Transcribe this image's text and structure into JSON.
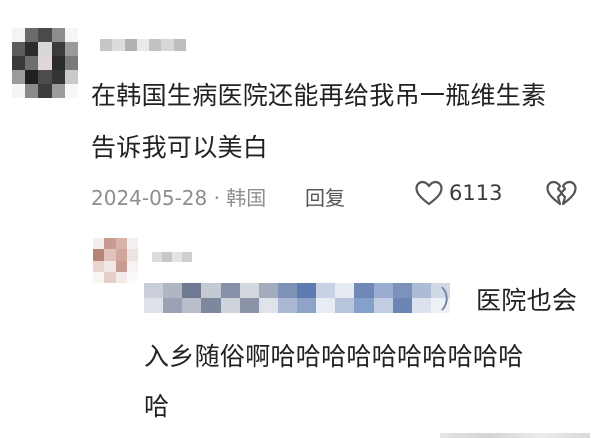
{
  "comment": {
    "text_line1": "在韩国生病医院还能再给我吊一瓶维生素",
    "text_line2": "告诉我可以美白",
    "date": "2024-05-28 · 韩国",
    "reply_label": "回复",
    "like_count": "6113",
    "icons": {
      "like": "heart-outline-icon",
      "dislike": "broken-heart-icon"
    }
  },
  "reply": {
    "mention_close": "）",
    "text_line1": "医院也会",
    "text_line2": "入乡随俗啊哈哈哈哈哈哈哈哈哈哈",
    "text_line3": "哈"
  },
  "colors": {
    "text": "#222222",
    "meta": "#8e8e8e",
    "icon": "#555555"
  }
}
